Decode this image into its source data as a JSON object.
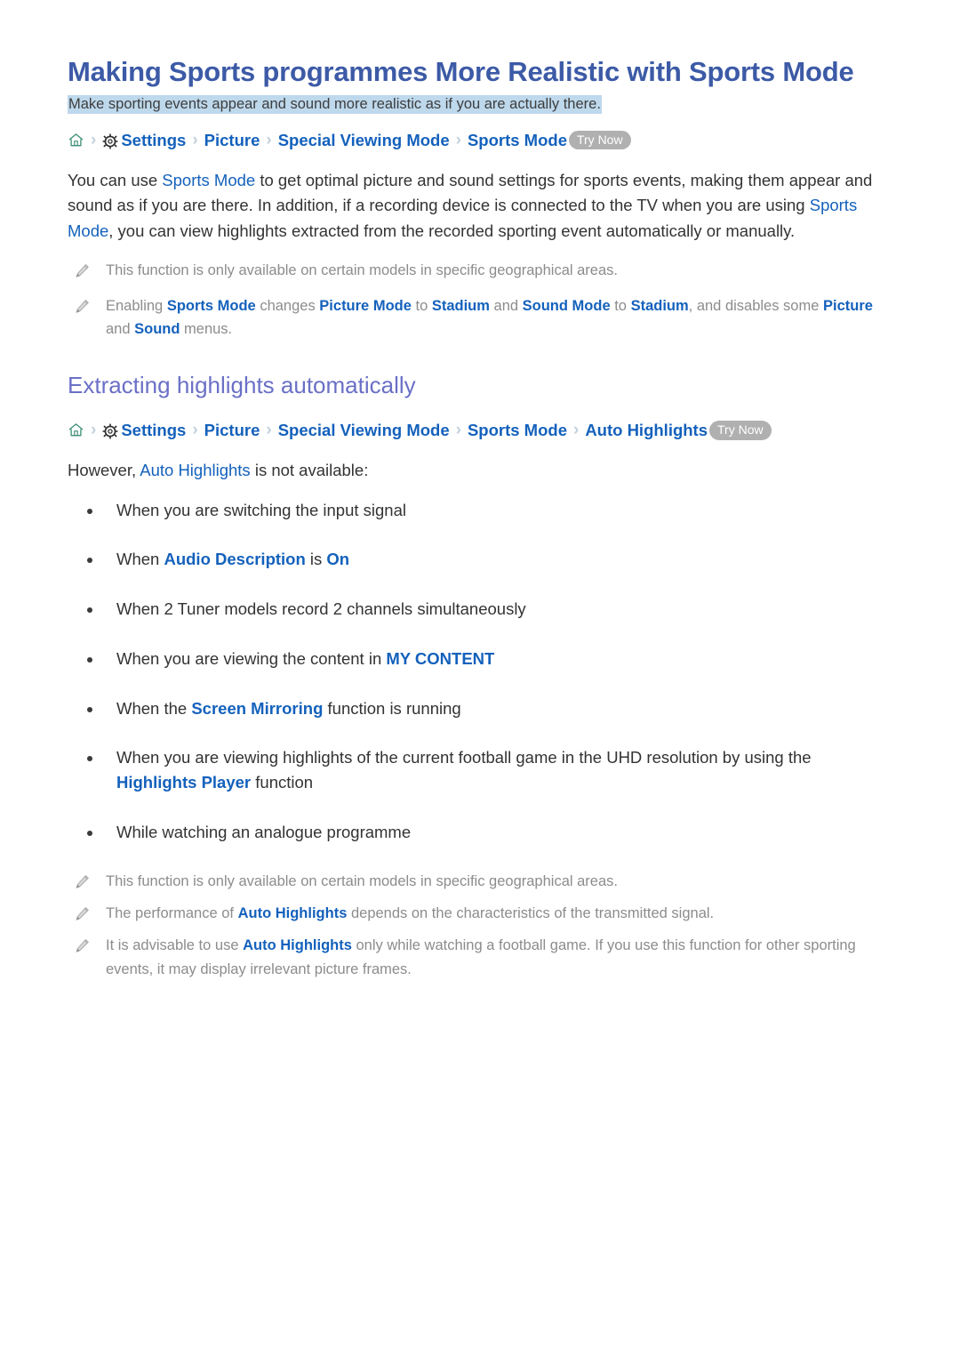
{
  "page": {
    "title": "Making Sports programmes More Realistic with Sports Mode",
    "subtitle": "Make sporting events appear and sound more realistic as if you are actually there."
  },
  "colors": {
    "title": "#3C5AA6",
    "section_heading": "#6A70C6",
    "link": "#1461BC",
    "highlight_band": "#BED8EC",
    "note_text": "#8C8C8C",
    "badge": "#B0B0B0",
    "body_text": "#333333"
  },
  "breadcrumb_main": {
    "home_icon": "home-icon",
    "gear_icon": "gear-icon",
    "separator": "›",
    "items": [
      {
        "label": "Settings"
      },
      {
        "label": "Picture"
      },
      {
        "label": "Special Viewing Mode"
      },
      {
        "label": "Sports Mode"
      }
    ],
    "badge": "Try Now"
  },
  "intro_paragraph": {
    "part1": "You can use ",
    "link1": "Sports Mode",
    "part2": " to get optimal picture and sound settings for sports events, making them appear and sound as if you are there. In addition, if a recording device is connected to the TV when you are using ",
    "link2": "Sports Mode",
    "part3": ", you can view highlights extracted from the recorded sporting event automatically or manually."
  },
  "notes_top": [
    {
      "icon": "pencil-icon",
      "text": "This function is only available on certain models in specific geographical areas."
    },
    {
      "icon": "pencil-icon",
      "p1": "Enabling ",
      "t1": "Sports Mode",
      "p2": " changes ",
      "t2": "Picture Mode",
      "p3": " to ",
      "t3": "Stadium",
      "p4": " and ",
      "t4": "Sound Mode",
      "p5": " to ",
      "t5": "Stadium",
      "p6": ", and disables some ",
      "t6": "Picture",
      "p7": " and ",
      "t7": "Sound",
      "p8": " menus."
    }
  ],
  "section": {
    "heading": "Extracting highlights automatically"
  },
  "breadcrumb_section": {
    "home_icon": "home-icon",
    "gear_icon": "gear-icon",
    "separator": "›",
    "items": [
      {
        "label": "Settings"
      },
      {
        "label": "Picture"
      },
      {
        "label": "Special Viewing Mode"
      },
      {
        "label": "Sports Mode"
      },
      {
        "label": "Auto Highlights"
      }
    ],
    "badge": "Try Now"
  },
  "availability_lead": {
    "p1": "However, ",
    "t1": "Auto Highlights",
    "p2": " is not available:"
  },
  "bullets": [
    {
      "p1": "When you are switching the input signal",
      "t1": "",
      "p2": "",
      "t2": "",
      "p3": ""
    },
    {
      "p1": "When ",
      "t1": "Audio Description",
      "p2": " is ",
      "t2": "On",
      "p3": ""
    },
    {
      "p1": "When 2 Tuner models record 2 channels simultaneously",
      "t1": "",
      "p2": "",
      "t2": "",
      "p3": ""
    },
    {
      "p1": "When you are viewing the content in ",
      "t1": "MY CONTENT",
      "p2": "",
      "t2": "",
      "p3": ""
    },
    {
      "p1": "When the ",
      "t1": "Screen Mirroring",
      "p2": " function is running",
      "t2": "",
      "p3": ""
    },
    {
      "p1": "When you are viewing highlights of the current football game in the UHD resolution by using the ",
      "t1": "Highlights Player",
      "p2": " function",
      "t2": "",
      "p3": ""
    },
    {
      "p1": "While watching an analogue programme",
      "t1": "",
      "p2": "",
      "t2": "",
      "p3": ""
    }
  ],
  "notes_bottom": [
    {
      "icon": "pencil-icon",
      "p1": "This function is only available on certain models in specific geographical areas.",
      "t1": "",
      "p2": ""
    },
    {
      "icon": "pencil-icon",
      "p1": "The performance of ",
      "t1": "Auto Highlights",
      "p2": " depends on the characteristics of the transmitted signal."
    },
    {
      "icon": "pencil-icon",
      "p1": "It is advisable to use ",
      "t1": "Auto Highlights",
      "p2": " only while watching a football game. If you use this function for other sporting events, it may display irrelevant picture frames."
    }
  ]
}
